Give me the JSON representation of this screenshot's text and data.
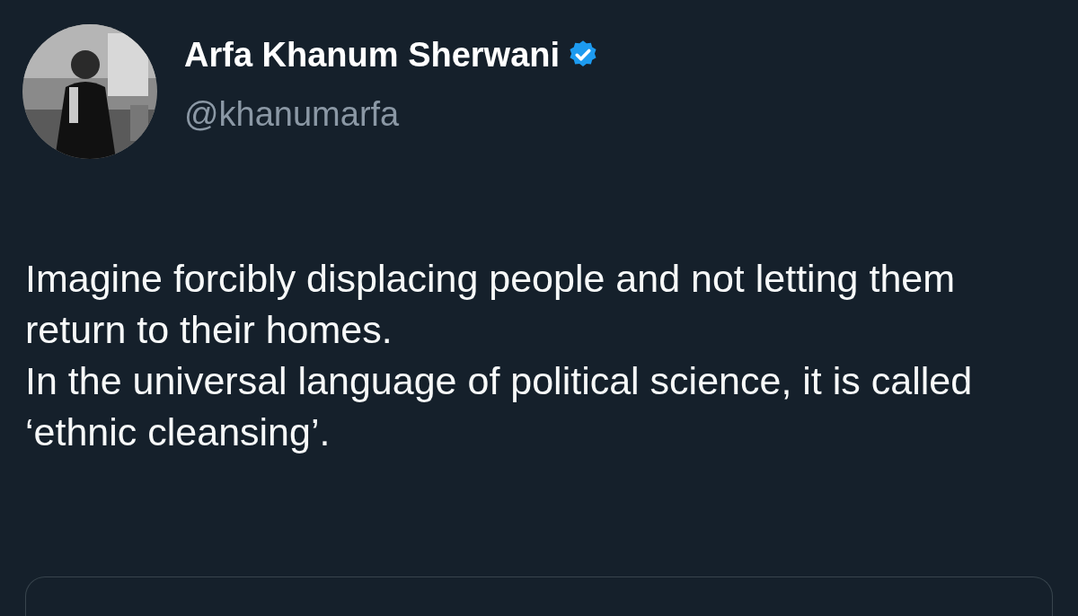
{
  "author": {
    "name": "Arfa Khanum Sherwani",
    "verified": true,
    "handle": "@khanumarfa"
  },
  "tweet": {
    "text": "Imagine forcibly displacing people and not letting them return to their homes.\nIn the universal language of political science, it is called ‘ethnic cleansing’."
  }
}
